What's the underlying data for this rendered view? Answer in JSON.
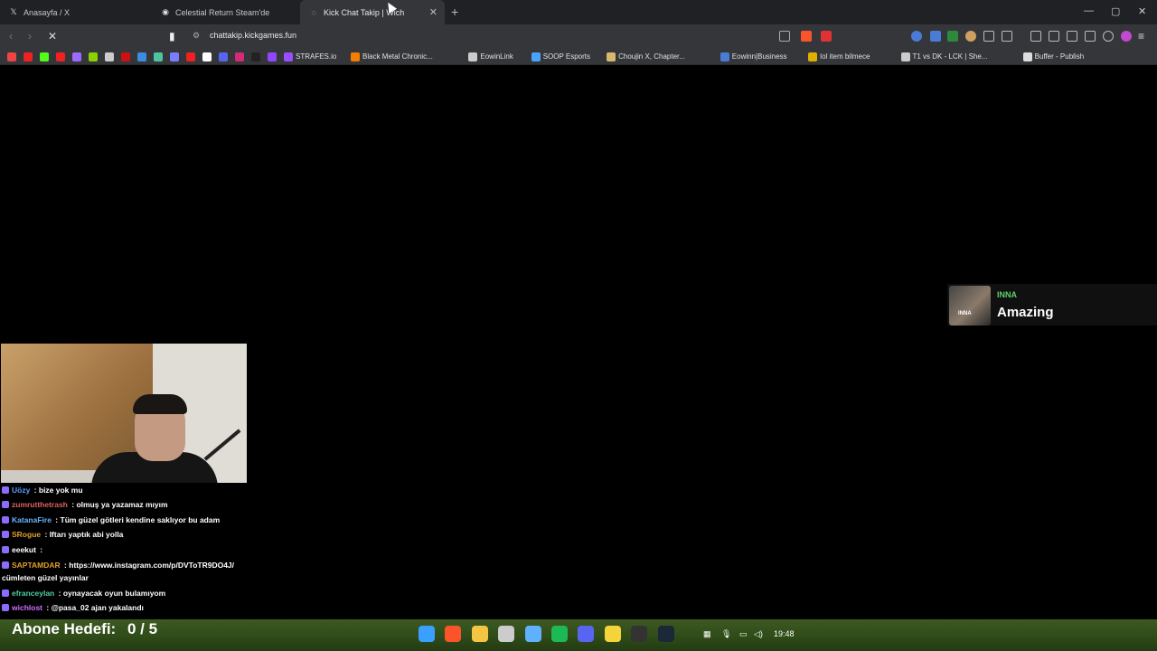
{
  "browser": {
    "tabs": [
      {
        "title": "Anasayfa / X",
        "icon": "x-logo-icon"
      },
      {
        "title": "Celestial Return Steam'de",
        "icon": "steam-icon"
      },
      {
        "title": "Kick Chat Takip | Wich",
        "icon": "loading-icon",
        "active": true
      }
    ],
    "new_tab": "+",
    "window_controls": {
      "minimize": "—",
      "maximize": "▢",
      "close": "✕"
    },
    "url": "chattakip.kickgames.fun",
    "bookmarks": [
      {
        "label": "",
        "icon": "gmail-icon",
        "color": "#e44"
      },
      {
        "label": "",
        "icon": "youtube-icon",
        "color": "#e22"
      },
      {
        "label": "",
        "icon": "kick-icon",
        "color": "#53fc18"
      },
      {
        "label": "",
        "icon": "youtube-icon",
        "color": "#e22"
      },
      {
        "label": "",
        "icon": "sync-icon",
        "color": "#9b6bff"
      },
      {
        "label": "",
        "icon": "cross-icon",
        "color": "#8bd100"
      },
      {
        "label": "",
        "icon": "globe-icon",
        "color": "#ccc"
      },
      {
        "label": "",
        "icon": "youtube-icon",
        "color": "#c11"
      },
      {
        "label": "",
        "icon": "l-icon",
        "color": "#3a8de0"
      },
      {
        "label": "",
        "icon": "d-icon",
        "color": "#4fc3a1"
      },
      {
        "label": "",
        "icon": "chat-icon",
        "color": "#7c7cff"
      },
      {
        "label": "",
        "icon": "youtube-icon",
        "color": "#e22"
      },
      {
        "label": "",
        "icon": "x-logo-icon",
        "color": "#fff"
      },
      {
        "label": "",
        "icon": "discord-icon",
        "color": "#5865f2"
      },
      {
        "label": "",
        "icon": "instagram-icon",
        "color": "#d62976"
      },
      {
        "label": "",
        "icon": "kr-icon",
        "color": "#222"
      },
      {
        "label": "",
        "icon": "twitch-icon",
        "color": "#9146ff"
      },
      {
        "label": "STRAFES.io",
        "icon": "strafes-icon",
        "color": "#9b4dff"
      },
      {
        "label": "Black Metal Chronic...",
        "icon": "blogger-icon",
        "color": "#f57d00"
      },
      {
        "label": "EowinLink",
        "icon": "globe-icon",
        "color": "#ccc"
      },
      {
        "label": "SOOP Esports",
        "icon": "soop-icon",
        "color": "#4aa3ff"
      },
      {
        "label": "Choujin X, Chapter...",
        "icon": "manga-icon",
        "color": "#d8b86a"
      },
      {
        "label": "Eowinn|Business",
        "icon": "e-icon",
        "color": "#4a7bd6"
      },
      {
        "label": "lol item bilmece",
        "icon": "b-icon",
        "color": "#e0b000"
      },
      {
        "label": "T1 vs DK - LCK | She...",
        "icon": "lck-icon",
        "color": "#ccc"
      },
      {
        "label": "Buffer - Publish",
        "icon": "buffer-icon",
        "color": "#ddd"
      }
    ]
  },
  "overlay": {
    "alert": {
      "user": "INNA",
      "message": "Amazing",
      "avatar_label": "INNA"
    },
    "chat": [
      {
        "user": "Uözy",
        "user_color": "#56a0ff",
        "text": "bize yok mu"
      },
      {
        "user": "zumrutthetrash",
        "user_color": "#e06060",
        "text": "olmuş ya yazamaz mıyım"
      },
      {
        "user": "KatanaFire",
        "user_color": "#6ab4ff",
        "text": "Tüm güzel götleri kendine saklıyor bu adam"
      },
      {
        "user": "SRogue",
        "user_color": "#e0a030",
        "text": "Iftarı yaptık abi yolla"
      },
      {
        "user": "eeekut",
        "user_color": "#ffffff",
        "text": ""
      },
      {
        "user": "SAPTAMDAR",
        "user_color": "#e0a030",
        "text": "https://www.instagram.com/p/DVToTR9DO4J/"
      },
      {
        "user": "",
        "user_color": "#ffffff",
        "text": "cümleten güzel yayınlar"
      },
      {
        "user": "efranceylan",
        "user_color": "#4fd0a0",
        "text": "oynayacak oyun bulamıyom"
      },
      {
        "user": "wichlost",
        "user_color": "#d070ff",
        "text": "@pasa_02 ajan yakalandı"
      }
    ],
    "goal": {
      "label": "Abone Hedefi:",
      "value": "0 / 5"
    }
  },
  "taskbar": {
    "apps": [
      {
        "icon": "windows-start-icon",
        "color": "#3aa0ff"
      },
      {
        "icon": "brave-icon",
        "color": "#fb542b"
      },
      {
        "icon": "file-explorer-icon",
        "color": "#f4c542"
      },
      {
        "icon": "hammer-icon",
        "color": "#cccccc"
      },
      {
        "icon": "network-icon",
        "color": "#5fb0ff"
      },
      {
        "icon": "spotify-icon",
        "color": "#1db954"
      },
      {
        "icon": "discord-icon",
        "color": "#5865f2"
      },
      {
        "icon": "sticky-notes-icon",
        "color": "#f5d33a"
      },
      {
        "icon": "obs-icon",
        "color": "#333333"
      },
      {
        "icon": "steam-icon",
        "color": "#1b2838"
      }
    ],
    "time": "19:48"
  }
}
